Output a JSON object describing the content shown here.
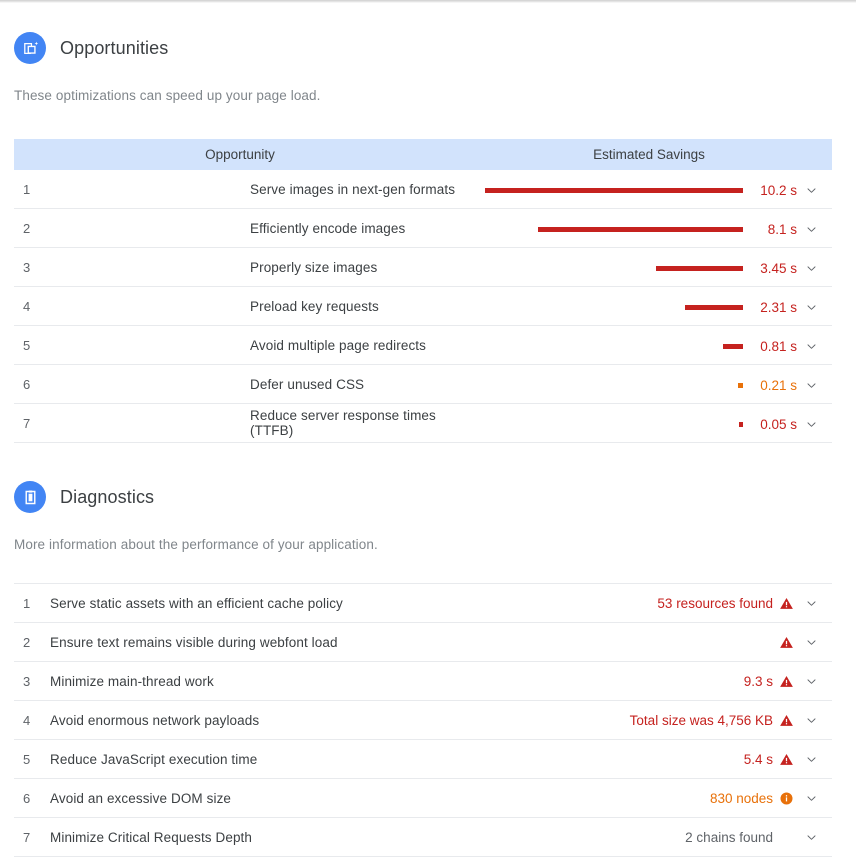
{
  "opportunities": {
    "icon": "opportunity-image-icon",
    "title": "Opportunities",
    "description": "These optimizations can speed up your page load.",
    "columns": {
      "name": "Opportunity",
      "savings": "Estimated Savings"
    },
    "bar_max_seconds": 10.2,
    "rows": [
      {
        "num": "1",
        "title": "Serve images in next-gen formats",
        "value": "10.2 s",
        "seconds": 10.2,
        "severity": "fail"
      },
      {
        "num": "2",
        "title": "Efficiently encode images",
        "value": "8.1 s",
        "seconds": 8.1,
        "severity": "fail"
      },
      {
        "num": "3",
        "title": "Properly size images",
        "value": "3.45 s",
        "seconds": 3.45,
        "severity": "fail"
      },
      {
        "num": "4",
        "title": "Preload key requests",
        "value": "2.31 s",
        "seconds": 2.31,
        "severity": "fail"
      },
      {
        "num": "5",
        "title": "Avoid multiple page redirects",
        "value": "0.81 s",
        "seconds": 0.81,
        "severity": "fail"
      },
      {
        "num": "6",
        "title": "Defer unused CSS",
        "value": "0.21 s",
        "seconds": 0.21,
        "severity": "warn"
      },
      {
        "num": "7",
        "title": "Reduce server response times (TTFB)",
        "value": "0.05 s",
        "seconds": 0.05,
        "severity": "fail"
      }
    ]
  },
  "diagnostics": {
    "icon": "diagnostics-clipboard-icon",
    "title": "Diagnostics",
    "description": "More information about the performance of your application.",
    "rows": [
      {
        "num": "1",
        "title": "Serve static assets with an efficient cache policy",
        "value": "53 resources found",
        "severity": "fail",
        "badge": "warning-triangle-icon"
      },
      {
        "num": "2",
        "title": "Ensure text remains visible during webfont load",
        "value": "",
        "severity": "fail",
        "badge": "warning-triangle-icon"
      },
      {
        "num": "3",
        "title": "Minimize main-thread work",
        "value": "9.3 s",
        "severity": "fail",
        "badge": "warning-triangle-icon"
      },
      {
        "num": "4",
        "title": "Avoid enormous network payloads",
        "value": "Total size was 4,756 KB",
        "severity": "fail",
        "badge": "warning-triangle-icon"
      },
      {
        "num": "5",
        "title": "Reduce JavaScript execution time",
        "value": "5.4 s",
        "severity": "fail",
        "badge": "warning-triangle-icon"
      },
      {
        "num": "6",
        "title": "Avoid an excessive DOM size",
        "value": "830 nodes",
        "severity": "warn",
        "badge": "info-circle-icon"
      },
      {
        "num": "7",
        "title": "Minimize Critical Requests Depth",
        "value": "2 chains found",
        "severity": "neutral",
        "badge": "none"
      }
    ]
  },
  "colors": {
    "header_background": "#d2e3fc",
    "brand_blue": "#4285f4",
    "fail_red": "#c5221f",
    "warn_orange": "#e8710a",
    "neutral_gray": "#5f6368",
    "divider": "#e8eaed"
  },
  "icons": {
    "chevron": "chevron-down-icon"
  }
}
